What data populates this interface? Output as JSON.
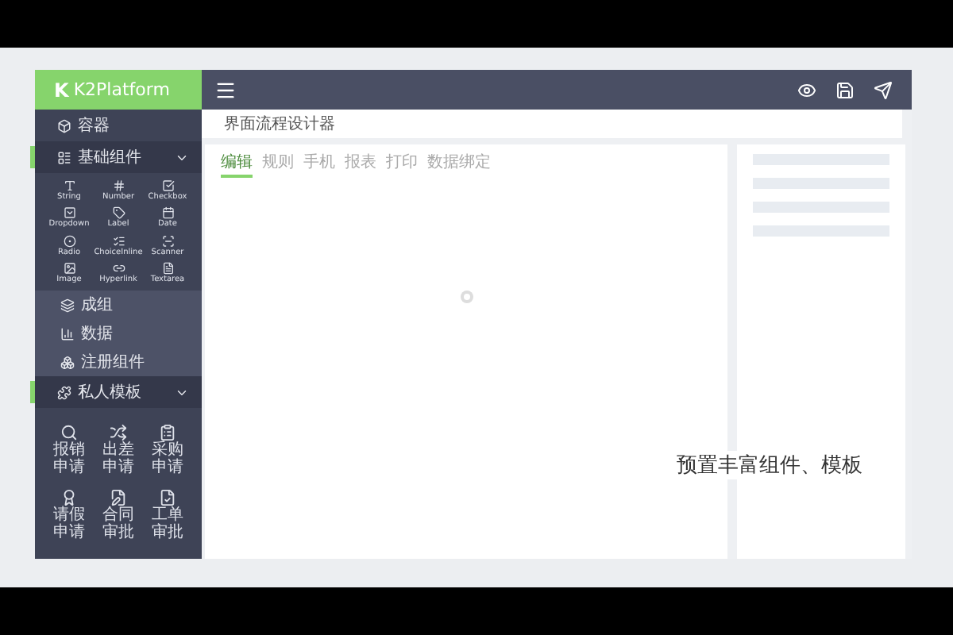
{
  "app": {
    "logo_mark": "K",
    "logo": "K2Platform"
  },
  "sidebar": {
    "sections": [
      {
        "kind": "link",
        "label": "容器"
      },
      {
        "kind": "group",
        "label": "基础组件",
        "expanded": true,
        "selected": true,
        "items": [
          "String",
          "Number",
          "Checkbox",
          "Dropdown",
          "Label",
          "Date",
          "Radio",
          "ChoiceInline",
          "Scanner",
          "Image",
          "Hyperlink",
          "Textarea"
        ]
      },
      {
        "kind": "sublink",
        "label": "成组"
      },
      {
        "kind": "sublink",
        "label": "数据"
      },
      {
        "kind": "sublink",
        "label": "注册组件"
      },
      {
        "kind": "group",
        "label": "私人模板",
        "expanded": true,
        "selected": true,
        "items": [
          "报销申请",
          "出差申请",
          "采购申请",
          "请假申请",
          "合同审批",
          "工单审批"
        ]
      }
    ]
  },
  "breadcrumb": "界面流程设计器",
  "tabs": [
    {
      "label": "编辑",
      "selected": true
    },
    {
      "label": "规则",
      "selected": false
    },
    {
      "label": "手机",
      "selected": false
    },
    {
      "label": "报表",
      "selected": false
    },
    {
      "label": "打印",
      "selected": false
    },
    {
      "label": "数据绑定",
      "selected": false
    }
  ],
  "caption": "预置丰富组件、模板"
}
